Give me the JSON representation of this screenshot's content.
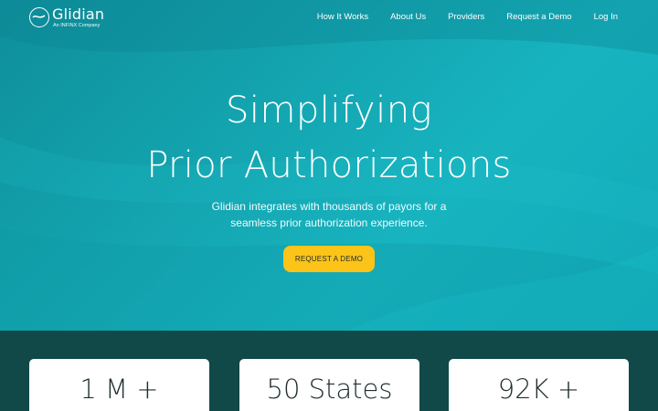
{
  "brand": {
    "name": "Glidian",
    "tagline": "An INFINX Company"
  },
  "nav": {
    "items": [
      {
        "label": "How It Works"
      },
      {
        "label": "About Us"
      },
      {
        "label": "Providers"
      },
      {
        "label": "Request a Demo"
      },
      {
        "label": "Log In"
      }
    ]
  },
  "hero": {
    "title_line1": "Simplifying",
    "title_line2": "Prior Authorizations",
    "subtitle_line1": "Glidian integrates with thousands of payors for a",
    "subtitle_line2": "seamless prior authorization experience.",
    "cta_label": "REQUEST A DEMO"
  },
  "stats": [
    {
      "value": "1 M +"
    },
    {
      "value": "50 States"
    },
    {
      "value": "92K +"
    }
  ],
  "colors": {
    "hero_teal": "#13a3ae",
    "stats_band": "#114848",
    "cta_yellow": "#fcc419"
  }
}
